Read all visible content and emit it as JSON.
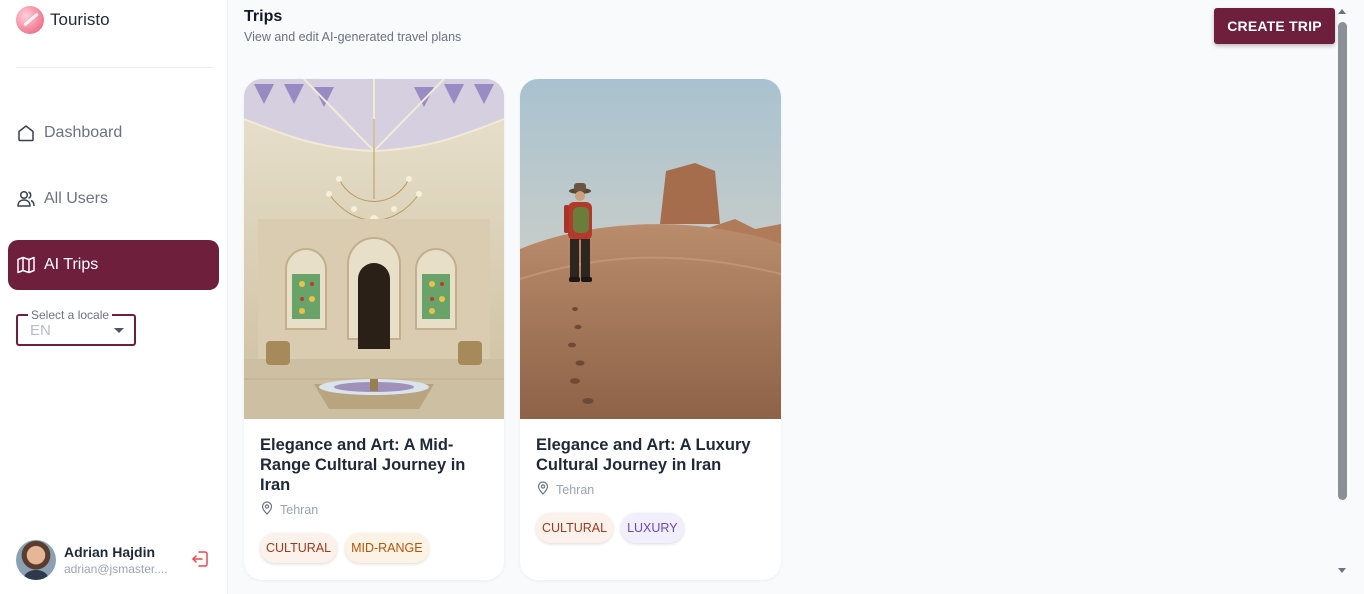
{
  "sidebar": {
    "brand": "Touristo",
    "nav": [
      {
        "label": "Dashboard",
        "icon": "home-icon"
      },
      {
        "label": "All Users",
        "icon": "users-icon"
      },
      {
        "label": "AI Trips",
        "icon": "map-icon",
        "active": true
      }
    ],
    "locale": {
      "label": "Select a locale",
      "value": "EN"
    },
    "user": {
      "name": "Adrian Hajdin",
      "email": "adrian@jsmaster...."
    }
  },
  "header": {
    "title": "Trips",
    "subtitle": "View and edit AI-generated travel plans",
    "create_button": "CREATE TRIP"
  },
  "trips": [
    {
      "title": "Elegance and Art: A Mid-Range Cultural Journey in Iran",
      "location": "Tehran",
      "tags": [
        "CULTURAL",
        "MID-RANGE"
      ],
      "image": "ornate-palace-hall-photo"
    },
    {
      "title": "Elegance and Art: A Luxury Cultural Journey in Iran",
      "location": "Tehran",
      "tags": [
        "CULTURAL",
        "LUXURY"
      ],
      "image": "desert-hiker-photo"
    }
  ],
  "colors": {
    "accent": "#6d1f3b",
    "page_bg": "#f9fafc",
    "tag_cultural": "#9a3b1b",
    "tag_midrange": "#b4540a",
    "tag_luxury": "#6b46c1"
  }
}
